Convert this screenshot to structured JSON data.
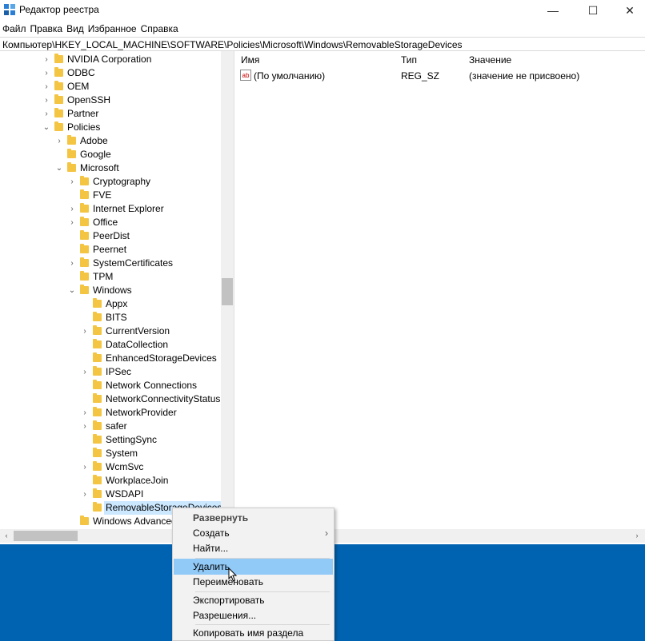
{
  "window": {
    "title": "Редактор реестра",
    "minimize": "—",
    "maximize": "☐",
    "close": "✕"
  },
  "menu": [
    "Файл",
    "Правка",
    "Вид",
    "Избранное",
    "Справка"
  ],
  "address": "Компьютер\\HKEY_LOCAL_MACHINE\\SOFTWARE\\Policies\\Microsoft\\Windows\\RemovableStorageDevices",
  "tree": [
    {
      "label": "NVIDIA Corporation",
      "chev": "›"
    },
    {
      "label": "ODBC",
      "chev": "›"
    },
    {
      "label": "OEM",
      "chev": "›"
    },
    {
      "label": "OpenSSH",
      "chev": "›"
    },
    {
      "label": "Partner",
      "chev": "›"
    },
    {
      "label": "Policies",
      "chev": "⌄"
    },
    {
      "label": "Adobe",
      "chev": "›"
    },
    {
      "label": "Google",
      "chev": ""
    },
    {
      "label": "Microsoft",
      "chev": "⌄"
    },
    {
      "label": "Cryptography",
      "chev": "›"
    },
    {
      "label": "FVE",
      "chev": ""
    },
    {
      "label": "Internet Explorer",
      "chev": "›"
    },
    {
      "label": "Office",
      "chev": "›"
    },
    {
      "label": "PeerDist",
      "chev": ""
    },
    {
      "label": "Peernet",
      "chev": ""
    },
    {
      "label": "SystemCertificates",
      "chev": "›"
    },
    {
      "label": "TPM",
      "chev": ""
    },
    {
      "label": "Windows",
      "chev": "⌄"
    },
    {
      "label": "Appx",
      "chev": ""
    },
    {
      "label": "BITS",
      "chev": ""
    },
    {
      "label": "CurrentVersion",
      "chev": "›"
    },
    {
      "label": "DataCollection",
      "chev": ""
    },
    {
      "label": "EnhancedStorageDevices",
      "chev": ""
    },
    {
      "label": "IPSec",
      "chev": "›"
    },
    {
      "label": "Network Connections",
      "chev": ""
    },
    {
      "label": "NetworkConnectivityStatus",
      "chev": ""
    },
    {
      "label": "NetworkProvider",
      "chev": "›"
    },
    {
      "label": "safer",
      "chev": "›"
    },
    {
      "label": "SettingSync",
      "chev": ""
    },
    {
      "label": "System",
      "chev": ""
    },
    {
      "label": "WcmSvc",
      "chev": "›"
    },
    {
      "label": "WorkplaceJoin",
      "chev": ""
    },
    {
      "label": "WSDAPI",
      "chev": "›"
    },
    {
      "label": "RemovableStorageDevices",
      "chev": ""
    },
    {
      "label": "Windows Advanced",
      "chev": ""
    }
  ],
  "columns": {
    "name": "Имя",
    "type": "Тип",
    "value": "Значение"
  },
  "values": [
    {
      "icon": "ab",
      "name": "(По умолчанию)",
      "type": "REG_SZ",
      "value": "(значение не присвоено)"
    }
  ],
  "context_menu": {
    "expand": "Развернуть",
    "create": "Создать",
    "create_arrow": "›",
    "find": "Найти...",
    "delete": "Удалить",
    "rename": "Переименовать",
    "export": "Экспортировать",
    "permissions": "Разрешения...",
    "copy_key_name": "Копировать имя раздела"
  },
  "scroll": {
    "left_arrow": "‹",
    "right_arrow": "›"
  }
}
